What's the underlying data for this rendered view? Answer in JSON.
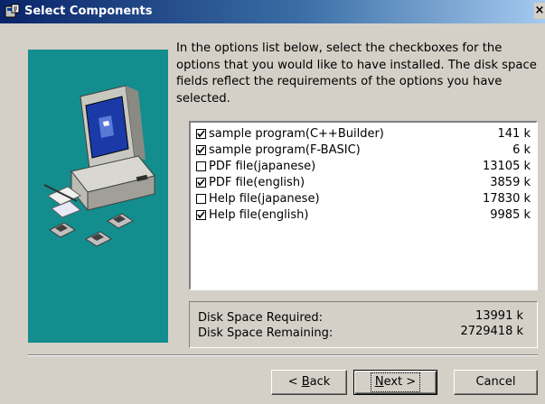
{
  "window": {
    "title": "Select Components",
    "close_label": "×"
  },
  "intro_text": "In the options list below, select the checkboxes for the options that you would like to have installed.  The disk space fields reflect the requirements of the options you have selected.",
  "components": [
    {
      "name": "sample program(C++Builder)",
      "size": "141 k",
      "checked": true
    },
    {
      "name": "sample program(F-BASIC)",
      "size": "6 k",
      "checked": true
    },
    {
      "name": "PDF file(japanese)",
      "size": "13105 k",
      "checked": false
    },
    {
      "name": "PDF file(english)",
      "size": "3859 k",
      "checked": true
    },
    {
      "name": "Help file(japanese)",
      "size": "17830 k",
      "checked": false
    },
    {
      "name": "Help file(english)",
      "size": "9985 k",
      "checked": true
    }
  ],
  "disk": {
    "required_label": "Disk Space Required:",
    "required_value": "13991 k",
    "remaining_label": "Disk Space Remaining:",
    "remaining_value": "2729418 k"
  },
  "buttons": {
    "back_prefix": "< ",
    "back_key": "B",
    "back_rest": "ack",
    "next_key": "N",
    "next_rest": "ext >",
    "cancel": "Cancel"
  },
  "colors": {
    "art_background": "#138d8d",
    "title_bar": "#0a246a"
  },
  "icons": [
    "installer-app-icon",
    "computer-illustration",
    "floppy-disk-icon",
    "checkbox-check-icon"
  ]
}
